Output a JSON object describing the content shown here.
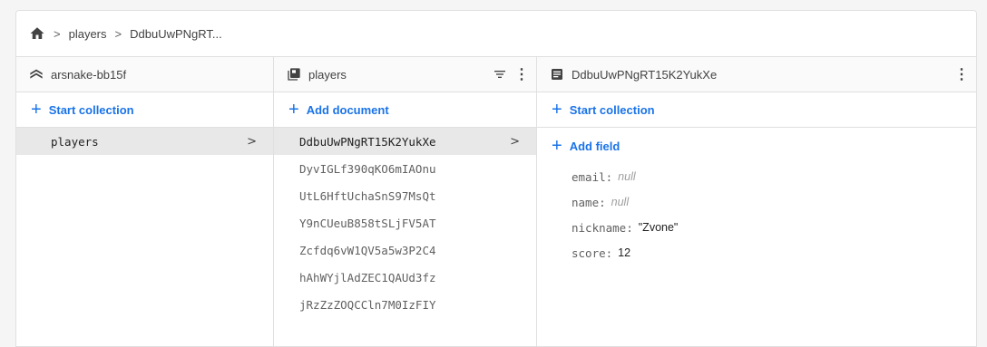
{
  "breadcrumb": {
    "items": [
      "players",
      "DdbuUwPNgRT..."
    ],
    "separator": ">"
  },
  "project_column": {
    "title": "arsnake-bb15f",
    "action_label": "Start collection",
    "items": [
      {
        "label": "players",
        "selected": true
      }
    ]
  },
  "collection_column": {
    "title": "players",
    "action_label": "Add document",
    "documents": [
      "DdbuUwPNgRT15K2YukXe",
      "DyvIGLf390qKO6mIAOnu",
      "UtL6HftUchaSnS97MsQt",
      "Y9nCUeuB858tSLjFV5AT",
      "Zcfdq6vW1QV5a5w3P2C4",
      "hAhWYjlAdZEC1QAUd3fz",
      "jRzZzZOQCCln7M0IzFIY"
    ]
  },
  "document_column": {
    "title": "DdbuUwPNgRT15K2YukXe",
    "action_label": "Start collection",
    "add_field_label": "Add field",
    "fields": [
      {
        "key": "email",
        "value": "null",
        "is_null": true
      },
      {
        "key": "name",
        "value": "null",
        "is_null": true
      },
      {
        "key": "nickname",
        "value": "\"Zvone\"",
        "is_null": false
      },
      {
        "key": "score",
        "value": "12",
        "is_null": false
      }
    ]
  },
  "chevron": ">",
  "plus": "+",
  "kebab": "⋮",
  "colors": {
    "accent": "#1a73e8",
    "selected_row": "#e8e8e8",
    "null_value": "#9e9e9e"
  },
  "icons": {
    "home": "home-icon",
    "project": "firestore-icon",
    "collection": "collection-icon",
    "document": "document-icon",
    "filter": "filter-icon",
    "more": "more-vert-icon"
  }
}
